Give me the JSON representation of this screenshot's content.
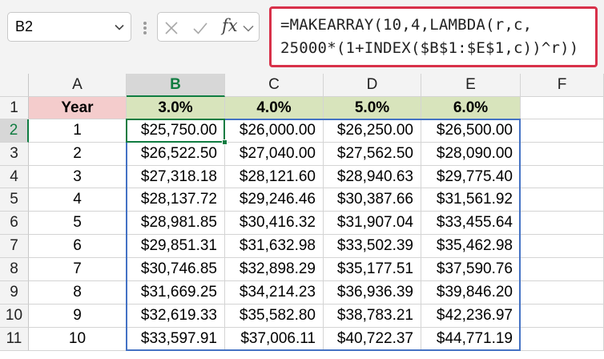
{
  "name_box": {
    "value": "B2"
  },
  "formula_bar": {
    "fx_label": "fx",
    "formula_line1": "=MAKEARRAY(10,4,LAMBDA(r,c,",
    "formula_line2": "25000*(1+INDEX($B$1:$E$1,c))^r))"
  },
  "colors": {
    "year_header_bg": "#f4cccc",
    "rate_header_bg": "#d8e4bc",
    "selection": "#107c41",
    "spill_border": "#4472c4",
    "formula_border": "#d8314a"
  },
  "sheet": {
    "column_headers": [
      "A",
      "B",
      "C",
      "D",
      "E",
      "F"
    ],
    "row_numbers": [
      "1",
      "2",
      "3",
      "4",
      "5",
      "6",
      "7",
      "8",
      "9",
      "10",
      "11"
    ],
    "selected_cell": "B2",
    "header_row": [
      "Year",
      "3.0%",
      "4.0%",
      "5.0%",
      "6.0%",
      ""
    ],
    "rows": [
      [
        "1",
        "$25,750.00",
        "$26,000.00",
        "$26,250.00",
        "$26,500.00",
        ""
      ],
      [
        "2",
        "$26,522.50",
        "$27,040.00",
        "$27,562.50",
        "$28,090.00",
        ""
      ],
      [
        "3",
        "$27,318.18",
        "$28,121.60",
        "$28,940.63",
        "$29,775.40",
        ""
      ],
      [
        "4",
        "$28,137.72",
        "$29,246.46",
        "$30,387.66",
        "$31,561.92",
        ""
      ],
      [
        "5",
        "$28,981.85",
        "$30,416.32",
        "$31,907.04",
        "$33,455.64",
        ""
      ],
      [
        "6",
        "$29,851.31",
        "$31,632.98",
        "$33,502.39",
        "$35,462.98",
        ""
      ],
      [
        "7",
        "$30,746.85",
        "$32,898.29",
        "$35,177.51",
        "$37,590.76",
        ""
      ],
      [
        "8",
        "$31,669.25",
        "$34,214.23",
        "$36,936.39",
        "$39,846.20",
        ""
      ],
      [
        "9",
        "$32,619.33",
        "$35,582.80",
        "$38,783.21",
        "$42,236.97",
        ""
      ],
      [
        "10",
        "$33,597.91",
        "$37,006.11",
        "$40,722.37",
        "$44,771.19",
        ""
      ]
    ]
  }
}
